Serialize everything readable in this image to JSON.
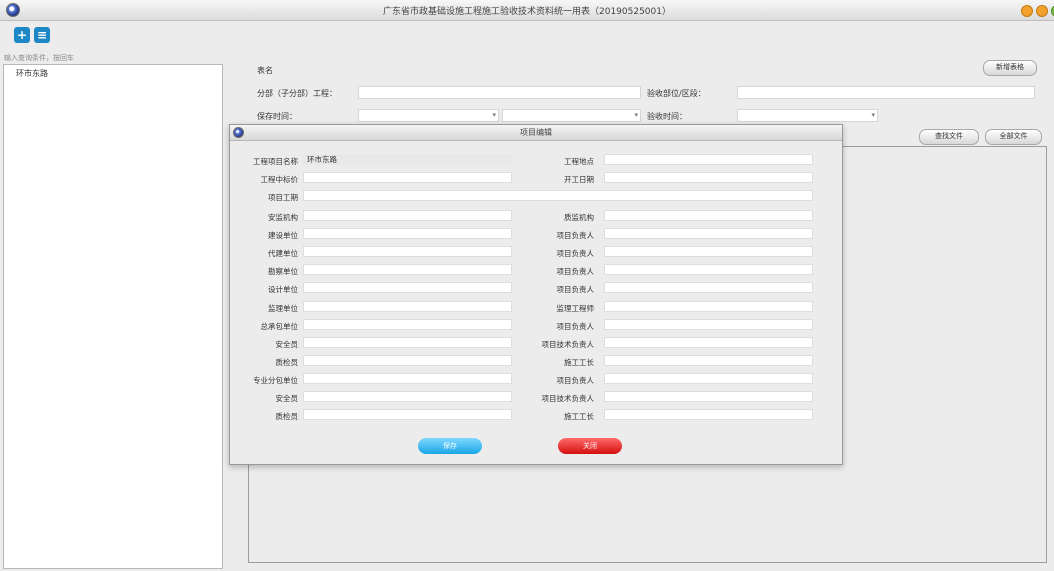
{
  "window": {
    "title": "广东省市政基础设施工程施工验收技术资料统一用表（20190525001）"
  },
  "toolbar": {
    "add_icon": "add-record-icon",
    "list_icon": "list-icon"
  },
  "sidebar": {
    "search_placeholder": "输入查询条件，按回车",
    "tree_items": [
      "环市东路"
    ]
  },
  "form": {
    "table_name_label": "表名",
    "subproject_label": "分部（子分部）工程：",
    "acceptance_part_label": "验收部位/区段：",
    "save_time_label": "保存时间：",
    "acceptance_time_label": "验收时间：",
    "dropdown_glyph": "▾",
    "new_table_button": "新增表格",
    "search_file_button": "查找文件",
    "all_files_button": "全部文件"
  },
  "dialog": {
    "title": "项目编辑",
    "project_name_label": "工程项目名称",
    "project_name_value": "环市东路",
    "project_location_label": "工程地点",
    "bid_price_label": "工程中标价",
    "start_date_label": "开工日期",
    "project_duration_label": "项目工期",
    "rows": [
      {
        "left": "安监机构",
        "right": "质监机构"
      },
      {
        "left": "建设单位",
        "right": "项目负责人"
      },
      {
        "left": "代建单位",
        "right": "项目负责人"
      },
      {
        "left": "勘察单位",
        "right": "项目负责人"
      },
      {
        "left": "设计单位",
        "right": "项目负责人"
      },
      {
        "left": "监理单位",
        "right": "监理工程师"
      },
      {
        "left": "总承包单位",
        "right": "项目负责人"
      },
      {
        "left": "安全员",
        "right": "项目技术负责人"
      },
      {
        "left": "质检员",
        "right": "施工工长"
      },
      {
        "left": "专业分包单位",
        "right": "项目负责人"
      },
      {
        "left": "安全员",
        "right": "项目技术负责人"
      },
      {
        "left": "质检员",
        "right": "施工工长"
      }
    ],
    "save_button": "保存",
    "close_button": "关闭",
    "save_color": "#2bb6ee",
    "close_color": "#e21a1a"
  }
}
